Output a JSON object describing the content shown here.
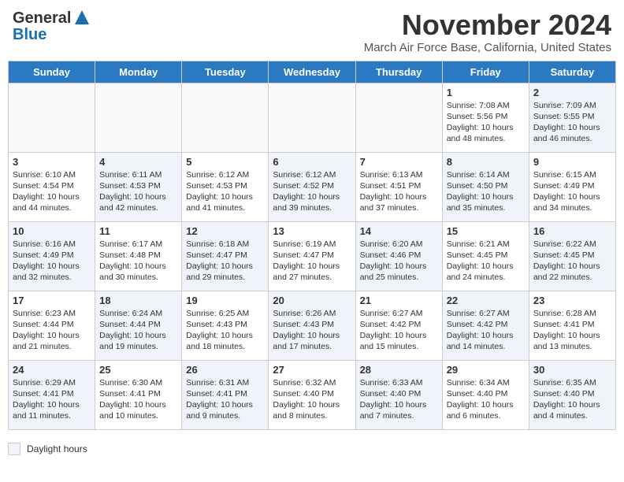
{
  "header": {
    "logo_general": "General",
    "logo_blue": "Blue",
    "month_title": "November 2024",
    "location": "March Air Force Base, California, United States"
  },
  "days_of_week": [
    "Sunday",
    "Monday",
    "Tuesday",
    "Wednesday",
    "Thursday",
    "Friday",
    "Saturday"
  ],
  "legend": {
    "label": "Daylight hours"
  },
  "weeks": [
    {
      "days": [
        {
          "number": "",
          "content": "",
          "empty": true
        },
        {
          "number": "",
          "content": "",
          "empty": true
        },
        {
          "number": "",
          "content": "",
          "empty": true
        },
        {
          "number": "",
          "content": "",
          "empty": true
        },
        {
          "number": "",
          "content": "",
          "empty": true
        },
        {
          "number": "1",
          "content": "Sunrise: 7:08 AM\nSunset: 5:56 PM\nDaylight: 10 hours\nand 48 minutes.",
          "empty": false,
          "shaded": false
        },
        {
          "number": "2",
          "content": "Sunrise: 7:09 AM\nSunset: 5:55 PM\nDaylight: 10 hours\nand 46 minutes.",
          "empty": false,
          "shaded": true
        }
      ]
    },
    {
      "days": [
        {
          "number": "3",
          "content": "Sunrise: 6:10 AM\nSunset: 4:54 PM\nDaylight: 10 hours\nand 44 minutes.",
          "empty": false,
          "shaded": false
        },
        {
          "number": "4",
          "content": "Sunrise: 6:11 AM\nSunset: 4:53 PM\nDaylight: 10 hours\nand 42 minutes.",
          "empty": false,
          "shaded": true
        },
        {
          "number": "5",
          "content": "Sunrise: 6:12 AM\nSunset: 4:53 PM\nDaylight: 10 hours\nand 41 minutes.",
          "empty": false,
          "shaded": false
        },
        {
          "number": "6",
          "content": "Sunrise: 6:12 AM\nSunset: 4:52 PM\nDaylight: 10 hours\nand 39 minutes.",
          "empty": false,
          "shaded": true
        },
        {
          "number": "7",
          "content": "Sunrise: 6:13 AM\nSunset: 4:51 PM\nDaylight: 10 hours\nand 37 minutes.",
          "empty": false,
          "shaded": false
        },
        {
          "number": "8",
          "content": "Sunrise: 6:14 AM\nSunset: 4:50 PM\nDaylight: 10 hours\nand 35 minutes.",
          "empty": false,
          "shaded": true
        },
        {
          "number": "9",
          "content": "Sunrise: 6:15 AM\nSunset: 4:49 PM\nDaylight: 10 hours\nand 34 minutes.",
          "empty": false,
          "shaded": false
        }
      ]
    },
    {
      "days": [
        {
          "number": "10",
          "content": "Sunrise: 6:16 AM\nSunset: 4:49 PM\nDaylight: 10 hours\nand 32 minutes.",
          "empty": false,
          "shaded": true
        },
        {
          "number": "11",
          "content": "Sunrise: 6:17 AM\nSunset: 4:48 PM\nDaylight: 10 hours\nand 30 minutes.",
          "empty": false,
          "shaded": false
        },
        {
          "number": "12",
          "content": "Sunrise: 6:18 AM\nSunset: 4:47 PM\nDaylight: 10 hours\nand 29 minutes.",
          "empty": false,
          "shaded": true
        },
        {
          "number": "13",
          "content": "Sunrise: 6:19 AM\nSunset: 4:47 PM\nDaylight: 10 hours\nand 27 minutes.",
          "empty": false,
          "shaded": false
        },
        {
          "number": "14",
          "content": "Sunrise: 6:20 AM\nSunset: 4:46 PM\nDaylight: 10 hours\nand 25 minutes.",
          "empty": false,
          "shaded": true
        },
        {
          "number": "15",
          "content": "Sunrise: 6:21 AM\nSunset: 4:45 PM\nDaylight: 10 hours\nand 24 minutes.",
          "empty": false,
          "shaded": false
        },
        {
          "number": "16",
          "content": "Sunrise: 6:22 AM\nSunset: 4:45 PM\nDaylight: 10 hours\nand 22 minutes.",
          "empty": false,
          "shaded": true
        }
      ]
    },
    {
      "days": [
        {
          "number": "17",
          "content": "Sunrise: 6:23 AM\nSunset: 4:44 PM\nDaylight: 10 hours\nand 21 minutes.",
          "empty": false,
          "shaded": false
        },
        {
          "number": "18",
          "content": "Sunrise: 6:24 AM\nSunset: 4:44 PM\nDaylight: 10 hours\nand 19 minutes.",
          "empty": false,
          "shaded": true
        },
        {
          "number": "19",
          "content": "Sunrise: 6:25 AM\nSunset: 4:43 PM\nDaylight: 10 hours\nand 18 minutes.",
          "empty": false,
          "shaded": false
        },
        {
          "number": "20",
          "content": "Sunrise: 6:26 AM\nSunset: 4:43 PM\nDaylight: 10 hours\nand 17 minutes.",
          "empty": false,
          "shaded": true
        },
        {
          "number": "21",
          "content": "Sunrise: 6:27 AM\nSunset: 4:42 PM\nDaylight: 10 hours\nand 15 minutes.",
          "empty": false,
          "shaded": false
        },
        {
          "number": "22",
          "content": "Sunrise: 6:27 AM\nSunset: 4:42 PM\nDaylight: 10 hours\nand 14 minutes.",
          "empty": false,
          "shaded": true
        },
        {
          "number": "23",
          "content": "Sunrise: 6:28 AM\nSunset: 4:41 PM\nDaylight: 10 hours\nand 13 minutes.",
          "empty": false,
          "shaded": false
        }
      ]
    },
    {
      "days": [
        {
          "number": "24",
          "content": "Sunrise: 6:29 AM\nSunset: 4:41 PM\nDaylight: 10 hours\nand 11 minutes.",
          "empty": false,
          "shaded": true
        },
        {
          "number": "25",
          "content": "Sunrise: 6:30 AM\nSunset: 4:41 PM\nDaylight: 10 hours\nand 10 minutes.",
          "empty": false,
          "shaded": false
        },
        {
          "number": "26",
          "content": "Sunrise: 6:31 AM\nSunset: 4:41 PM\nDaylight: 10 hours\nand 9 minutes.",
          "empty": false,
          "shaded": true
        },
        {
          "number": "27",
          "content": "Sunrise: 6:32 AM\nSunset: 4:40 PM\nDaylight: 10 hours\nand 8 minutes.",
          "empty": false,
          "shaded": false
        },
        {
          "number": "28",
          "content": "Sunrise: 6:33 AM\nSunset: 4:40 PM\nDaylight: 10 hours\nand 7 minutes.",
          "empty": false,
          "shaded": true
        },
        {
          "number": "29",
          "content": "Sunrise: 6:34 AM\nSunset: 4:40 PM\nDaylight: 10 hours\nand 6 minutes.",
          "empty": false,
          "shaded": false
        },
        {
          "number": "30",
          "content": "Sunrise: 6:35 AM\nSunset: 4:40 PM\nDaylight: 10 hours\nand 4 minutes.",
          "empty": false,
          "shaded": true
        }
      ]
    }
  ]
}
